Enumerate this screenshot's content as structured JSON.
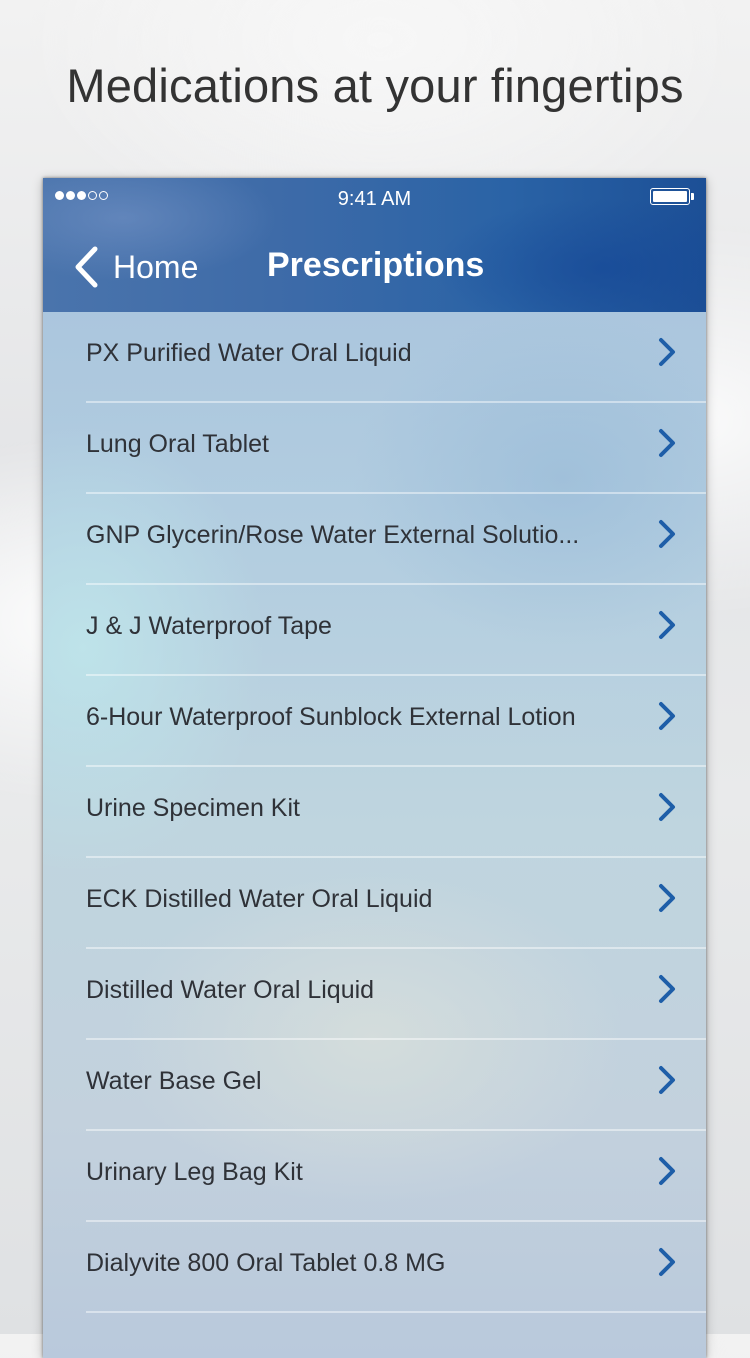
{
  "tagline": "Medications at your fingertips",
  "status_bar": {
    "time": "9:41 AM",
    "signal_filled": 3,
    "signal_total": 5,
    "battery_level": 1.0
  },
  "navbar": {
    "back_label": "Home",
    "title": "Prescriptions"
  },
  "colors": {
    "navbar": "#2a63a6",
    "chevron": "#1e5ea8",
    "text": "#2f3238"
  },
  "prescriptions": [
    {
      "label": "PX Purified Water Oral Liquid"
    },
    {
      "label": "Lung Oral Tablet"
    },
    {
      "label": "GNP Glycerin/Rose Water External Solutio..."
    },
    {
      "label": "J & J Waterproof Tape"
    },
    {
      "label": "6-Hour Waterproof Sunblock External Lotion"
    },
    {
      "label": "Urine Specimen Kit"
    },
    {
      "label": "ECK Distilled Water Oral Liquid"
    },
    {
      "label": "Distilled Water Oral Liquid"
    },
    {
      "label": "Water Base Gel"
    },
    {
      "label": "Urinary Leg Bag Kit"
    },
    {
      "label": "Dialyvite 800 Oral Tablet 0.8 MG"
    }
  ]
}
